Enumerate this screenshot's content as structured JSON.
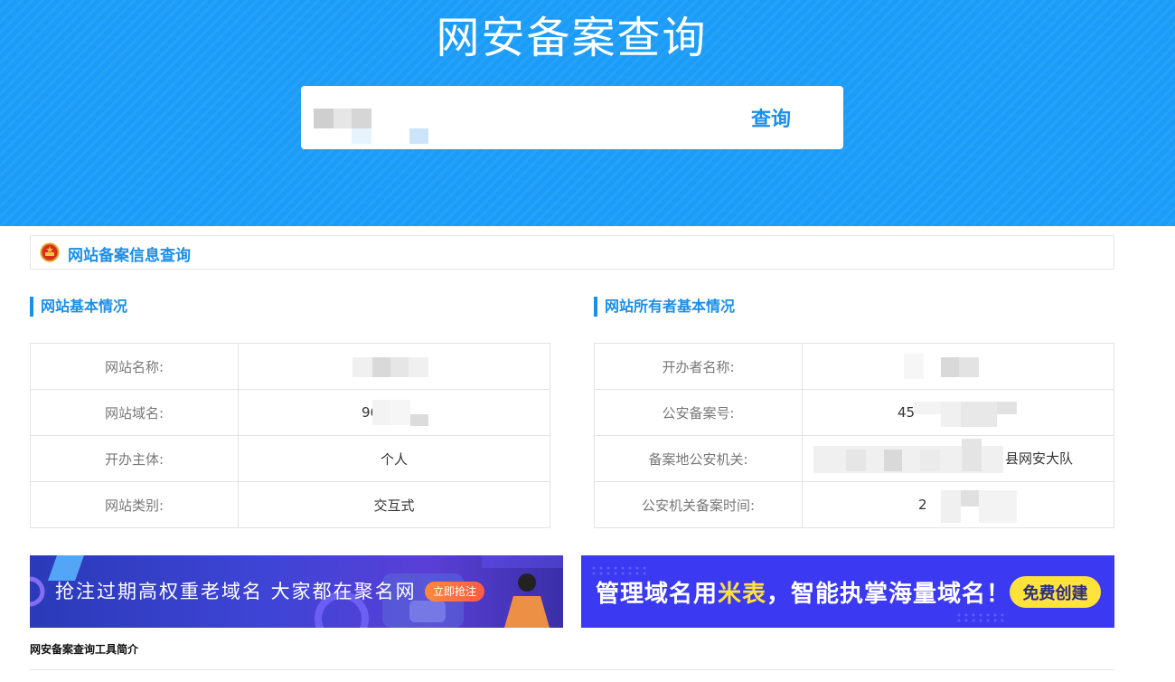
{
  "hero": {
    "title": "网安备案查询",
    "search": {
      "value": "",
      "button_label": "查询"
    }
  },
  "section": {
    "title": "网站备案信息查询",
    "emblem_icon": "police-emblem-icon"
  },
  "site_basic": {
    "heading": "网站基本情况",
    "rows": [
      {
        "label": "网站名称:",
        "value": ""
      },
      {
        "label": "网站域名:",
        "value": "96"
      },
      {
        "label": "开办主体:",
        "value": "个人"
      },
      {
        "label": "网站类别:",
        "value": "交互式"
      }
    ]
  },
  "owner_basic": {
    "heading": "网站所有者基本情况",
    "rows": [
      {
        "label": "开办者名称:",
        "value": ""
      },
      {
        "label": "公安备案号:",
        "value": "45"
      },
      {
        "label": "备案地公安机关:",
        "value": "县网安大队"
      },
      {
        "label": "公安机关备案时间:",
        "value": "2"
      }
    ]
  },
  "banners": {
    "left": {
      "text": "抢注过期高权重老域名 大家都在聚名网",
      "button_label": "立即抢注"
    },
    "right": {
      "text_before": "管理域名用",
      "text_highlight": "米表",
      "text_after": "，智能执掌海量域名！",
      "button_label": "免费创建"
    }
  },
  "footer": {
    "title": "网安备案查询工具简介"
  },
  "colors": {
    "hero_bg": "#1b9cf8",
    "accent": "#1b8ee6",
    "highlight_yellow": "#ffe23a"
  }
}
